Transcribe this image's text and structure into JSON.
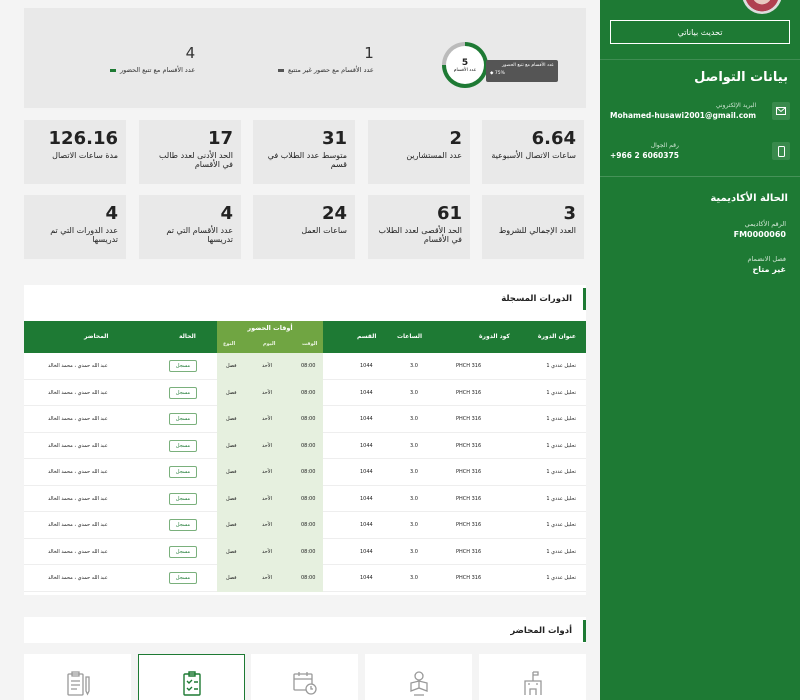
{
  "sidebar": {
    "update_button": "تحديث بياناتي",
    "contact_title": "بيانات التواصل",
    "email_label": "البريد الإلكتروني",
    "email": "Mohamed-husawi2001@gmail.com",
    "mobile_label": "رقم الجوال",
    "mobile": "+966 2 6060375",
    "academic_title": "الحالة الأكاديمية",
    "academic_id_label": "الرقم الأكاديمي",
    "academic_id": "FM0000060",
    "join_semester_label": "فصل الانضمام",
    "join_semester": "غير متاح"
  },
  "summary": {
    "items": [
      {
        "value": "4",
        "label": "عدد الأقسام مع تتبع الحضور",
        "color": "#1e7a34"
      },
      {
        "value": "1",
        "label": "عدد الأقسام مع حضور غير متتبع",
        "color": "#555555"
      }
    ],
    "donut_value": "5",
    "donut_label": "عدد الأقسام",
    "tooltip_label": "عدد الأقسام مع تتبع الحضور",
    "tooltip_value": "75%",
    "tracked_fraction": 0.75
  },
  "cards_row1": [
    {
      "value": "6.64",
      "label": "ساعات الاتصال الأسبوعية"
    },
    {
      "value": "2",
      "label": "عدد المستشارين"
    },
    {
      "value": "31",
      "label": "متوسط عدد الطلاب في قسم"
    },
    {
      "value": "17",
      "label": "الحد الأدنى لعدد طالب في الأقسام"
    },
    {
      "value": "126.16",
      "label": "مدة ساعات الاتصال"
    }
  ],
  "cards_row2": [
    {
      "value": "3",
      "label": "العدد الإجمالي للشروط"
    },
    {
      "value": "61",
      "label": "الحد الأقصى لعدد الطلاب في الأقسام"
    },
    {
      "value": "24",
      "label": "ساعات العمل"
    },
    {
      "value": "4",
      "label": "عدد الأقسام التي تم تدريسها"
    },
    {
      "value": "4",
      "label": "عدد الدورات التي تم تدريسها"
    }
  ],
  "courses": {
    "title": "الدورات المسجلة",
    "headers": {
      "course_title": "عنوان الدورة",
      "course_code": "كود الدورة",
      "hours": "الساعات",
      "section": "القسم",
      "attendance_group": "أوقات الحضور",
      "time": "الوقت",
      "day": "اليوم",
      "type": "النوع",
      "status": "الحالة",
      "instructor": "المحاضر"
    },
    "rows": [
      {
        "title": "تحليل عددي 1",
        "code": "PHCH 316",
        "hours": "3.0",
        "section": "1044",
        "time": "08:00",
        "day": "الأحد",
        "type": "فصل",
        "status": "مسجل",
        "instructor": "عبد الله حمدي ، محمد الخالد"
      },
      {
        "title": "تحليل عددي 1",
        "code": "PHCH 316",
        "hours": "3.0",
        "section": "1044",
        "time": "08:00",
        "day": "الأحد",
        "type": "فصل",
        "status": "مسجل",
        "instructor": "عبد الله حمدي ، محمد الخالد"
      },
      {
        "title": "تحليل عددي 1",
        "code": "PHCH 316",
        "hours": "3.0",
        "section": "1044",
        "time": "08:00",
        "day": "الأحد",
        "type": "فصل",
        "status": "مسجل",
        "instructor": "عبد الله حمدي ، محمد الخالد"
      },
      {
        "title": "تحليل عددي 1",
        "code": "PHCH 316",
        "hours": "3.0",
        "section": "1044",
        "time": "08:00",
        "day": "الأحد",
        "type": "فصل",
        "status": "مسجل",
        "instructor": "عبد الله حمدي ، محمد الخالد"
      },
      {
        "title": "تحليل عددي 1",
        "code": "PHCH 316",
        "hours": "3.0",
        "section": "1044",
        "time": "08:00",
        "day": "الأحد",
        "type": "فصل",
        "status": "مسجل",
        "instructor": "عبد الله حمدي ، محمد الخالد"
      },
      {
        "title": "تحليل عددي 1",
        "code": "PHCH 316",
        "hours": "3.0",
        "section": "1044",
        "time": "08:00",
        "day": "الأحد",
        "type": "فصل",
        "status": "مسجل",
        "instructor": "عبد الله حمدي ، محمد الخالد"
      },
      {
        "title": "تحليل عددي 1",
        "code": "PHCH 316",
        "hours": "3.0",
        "section": "1044",
        "time": "08:00",
        "day": "الأحد",
        "type": "فصل",
        "status": "مسجل",
        "instructor": "عبد الله حمدي ، محمد الخالد"
      },
      {
        "title": "تحليل عددي 1",
        "code": "PHCH 316",
        "hours": "3.0",
        "section": "1044",
        "time": "08:00",
        "day": "الأحد",
        "type": "فصل",
        "status": "مسجل",
        "instructor": "عبد الله حمدي ، محمد الخالد"
      },
      {
        "title": "تحليل عددي 1",
        "code": "PHCH 316",
        "hours": "3.0",
        "section": "1044",
        "time": "08:00",
        "day": "الأحد",
        "type": "فصل",
        "status": "مسجل",
        "instructor": "عبد الله حمدي ، محمد الخالد"
      }
    ]
  },
  "tools": {
    "title": "أدوات المحاضر",
    "items": [
      {
        "icon": "building-icon"
      },
      {
        "icon": "person-reading-icon"
      },
      {
        "icon": "calendar-clock-icon"
      },
      {
        "icon": "checklist-icon",
        "active": true
      },
      {
        "icon": "clipboard-pen-icon"
      }
    ]
  }
}
